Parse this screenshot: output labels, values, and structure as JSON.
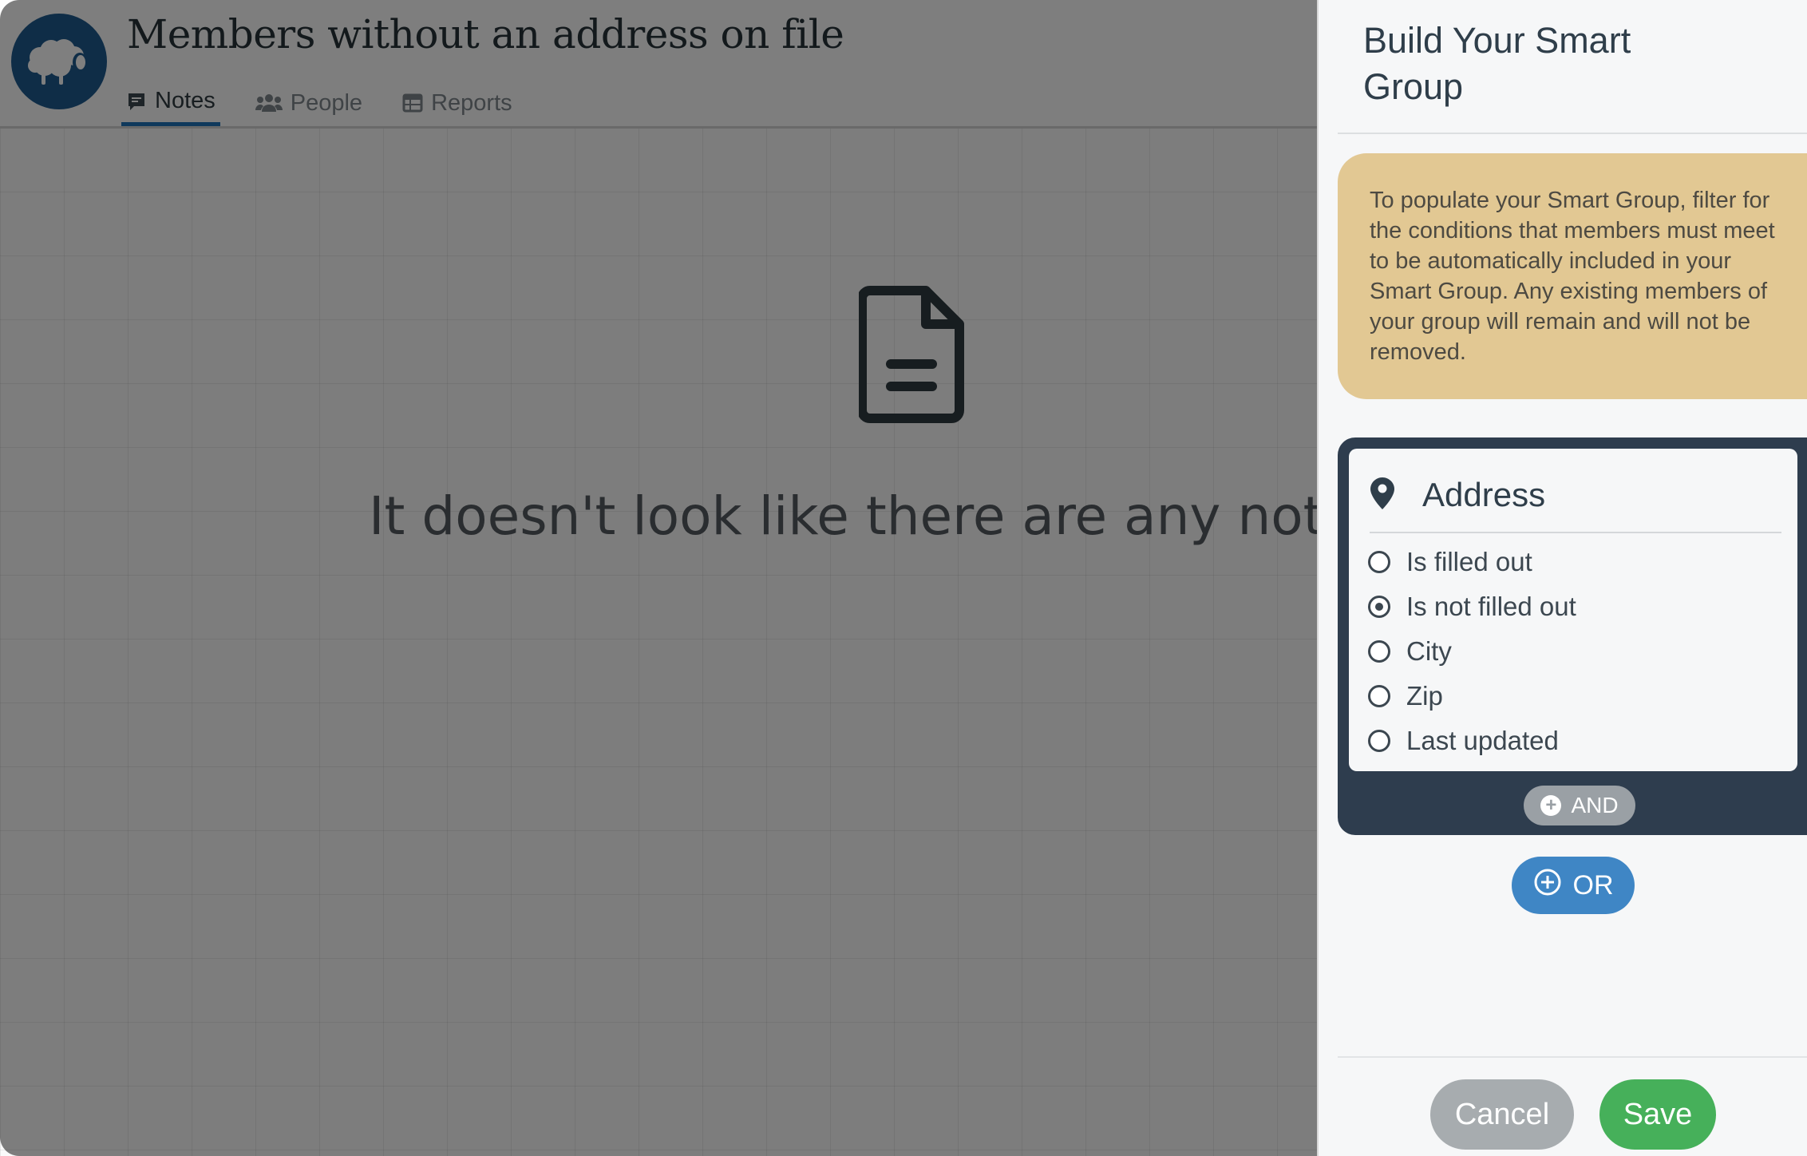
{
  "header": {
    "title": "Members without an address on file",
    "tabs": [
      {
        "label": "Notes",
        "icon": "notes-icon",
        "active": true
      },
      {
        "label": "People",
        "icon": "people-icon",
        "active": false
      },
      {
        "label": "Reports",
        "icon": "reports-icon",
        "active": false
      }
    ]
  },
  "main": {
    "empty_icon": "document-icon",
    "empty_message": "It doesn't look like there are any notes he"
  },
  "panel": {
    "title": "Build Your Smart Group",
    "info": "To populate your Smart Group, filter for the conditions that members must meet to be automatically included in your Smart Group. Any existing members of your group will remain and will not be removed.",
    "filter": {
      "icon": "map-pin-icon",
      "title": "Address",
      "options": [
        {
          "label": "Is filled out",
          "selected": false
        },
        {
          "label": "Is not filled out",
          "selected": true
        },
        {
          "label": "City",
          "selected": false
        },
        {
          "label": "Zip",
          "selected": false
        },
        {
          "label": "Last updated",
          "selected": false
        }
      ]
    },
    "and_label": "AND",
    "or_label": "OR",
    "cancel_label": "Cancel",
    "save_label": "Save"
  },
  "colors": {
    "brand": "#1e5a8e",
    "tab_underline": "#1e73b8",
    "info_bg": "#e2c893",
    "group_bg": "#2e3d4e",
    "or_button": "#3f86c5",
    "save_button": "#46b05a",
    "cancel_button": "#a7acaf"
  }
}
